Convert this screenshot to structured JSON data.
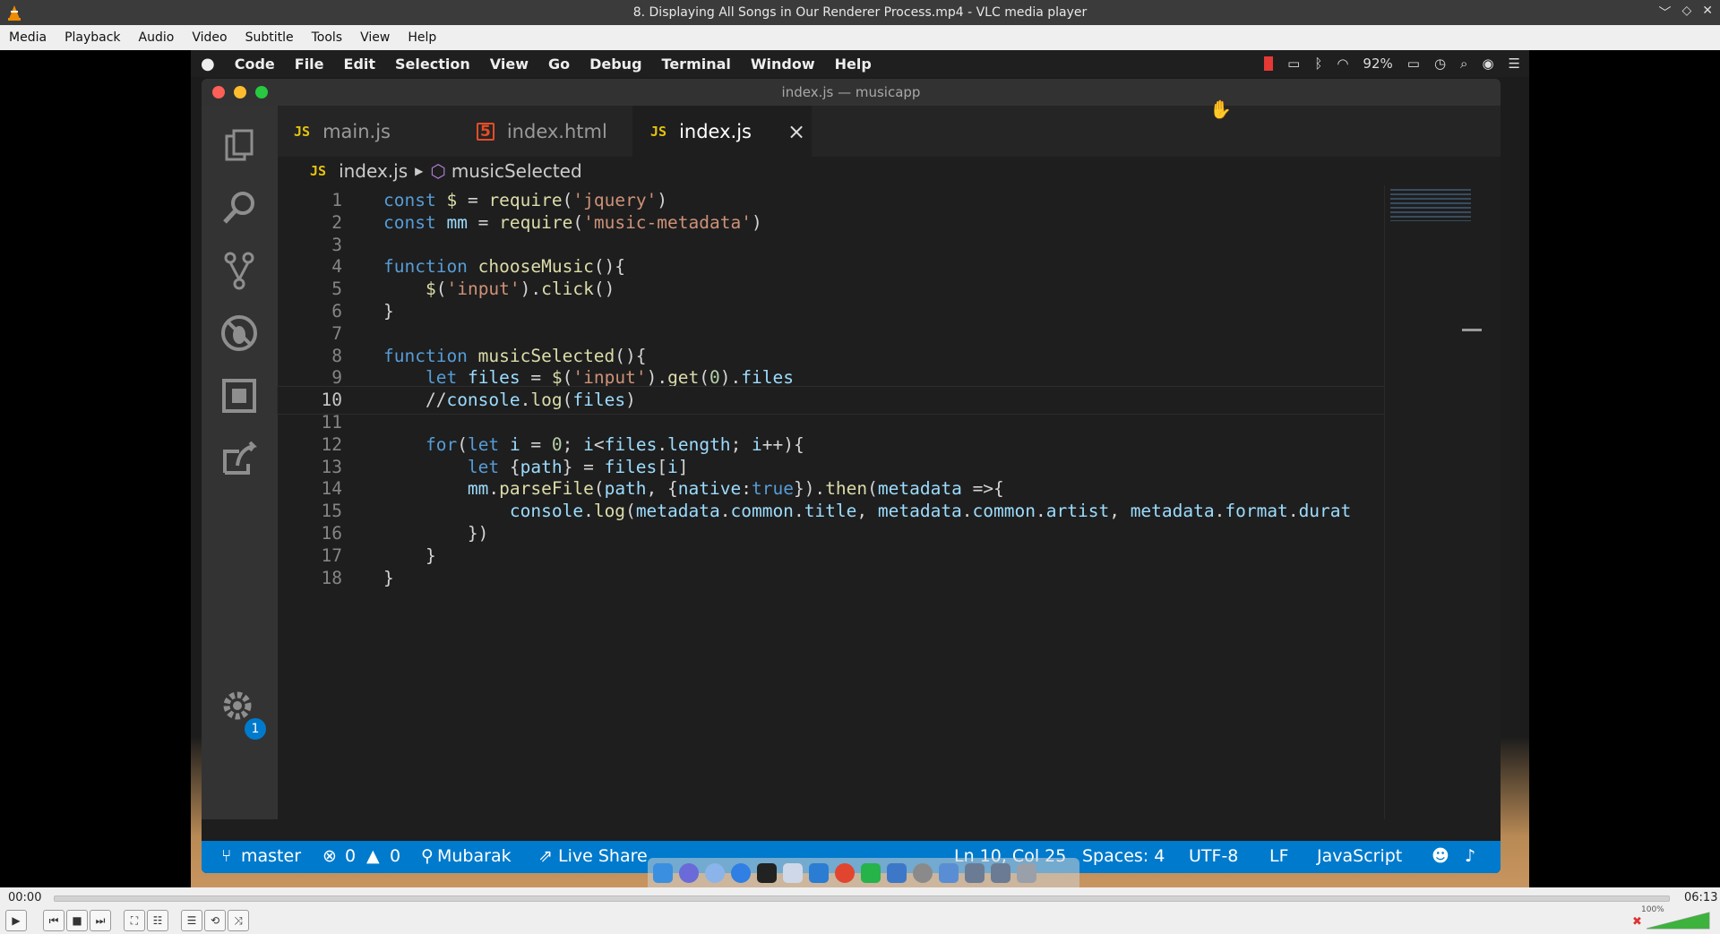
{
  "vlc": {
    "window_title": "8. Displaying All Songs in Our Renderer Process.mp4 - VLC media player",
    "menu": [
      "Media",
      "Playback",
      "Audio",
      "Video",
      "Subtitle",
      "Tools",
      "View",
      "Help"
    ],
    "time_elapsed": "00:00",
    "time_total": "06:13",
    "progress": 0,
    "volume_label": "100%",
    "volume_level": 1.0
  },
  "mac": {
    "menu": [
      "Code",
      "File",
      "Edit",
      "Selection",
      "View",
      "Go",
      "Debug",
      "Terminal",
      "Window",
      "Help"
    ],
    "battery": "92%"
  },
  "vscode": {
    "window_title": "index.js — musicapp",
    "tabs": [
      {
        "label": "main.js",
        "badge": "JS"
      },
      {
        "label": "index.html",
        "badge": "5"
      },
      {
        "label": "index.js",
        "badge": "JS",
        "close": "×"
      }
    ],
    "breadcrumb": {
      "file": "index.js",
      "symbol": "musicSelected"
    },
    "settings_badge": "1",
    "code_lines": [
      "const $ = require('jquery')",
      "const mm = require('music-metadata')",
      "",
      "function chooseMusic(){",
      "    $('input').click()",
      "}",
      "",
      "function musicSelected(){",
      "    let files = $('input').get(0).files",
      "    //console.log(files)",
      "",
      "    for(let i = 0; i<files.length; i++){",
      "        let {path} = files[i]",
      "        mm.parseFile(path, {native:true}).then(metadata =>{",
      "            console.log(metadata.common.title, metadata.common.artist, metadata.format.durat",
      "        })",
      "    }",
      "}"
    ],
    "line_numbers": [
      "1",
      "2",
      "3",
      "4",
      "5",
      "6",
      "7",
      "8",
      "9",
      "10",
      "11",
      "12",
      "13",
      "14",
      "15",
      "16",
      "17",
      "18"
    ],
    "status": {
      "branch": "master",
      "errors": "0",
      "warnings": "0",
      "user": "Mubarak",
      "live_share": "Live Share",
      "position": "Ln 10, Col 25",
      "spaces": "Spaces: 4",
      "encoding": "UTF-8",
      "eol": "LF",
      "language": "JavaScript"
    }
  }
}
